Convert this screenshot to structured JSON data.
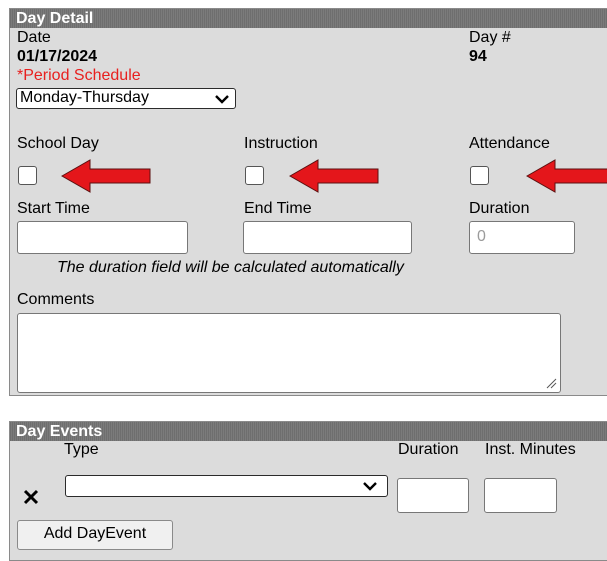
{
  "day_detail": {
    "header": "Day Detail",
    "date_label": "Date",
    "date_value": "01/17/2024",
    "day_num_label": "Day #",
    "day_num_value": "94",
    "period_schedule_label": "*Period Schedule",
    "period_schedule_value": "Monday-Thursday",
    "school_day_label": "School Day",
    "school_day_checked": false,
    "instruction_label": "Instruction",
    "instruction_checked": false,
    "attendance_label": "Attendance",
    "attendance_checked": false,
    "start_time_label": "Start Time",
    "start_time_value": "",
    "end_time_label": "End Time",
    "end_time_value": "",
    "duration_label": "Duration",
    "duration_placeholder": "0",
    "duration_note": "The duration field will be calculated automatically",
    "comments_label": "Comments",
    "comments_value": ""
  },
  "day_events": {
    "header": "Day Events",
    "col_type": "Type",
    "col_duration": "Duration",
    "col_inst_minutes": "Inst. Minutes",
    "row": {
      "delete_icon": "x-icon",
      "type_value": "",
      "duration_value": "",
      "inst_minutes_value": ""
    },
    "add_button_label": "Add DayEvent"
  },
  "colors": {
    "panel_bg": "#dcdcdc",
    "header_bg": "#737373",
    "required_text": "#e8201f",
    "arrow": "#e4161b"
  }
}
